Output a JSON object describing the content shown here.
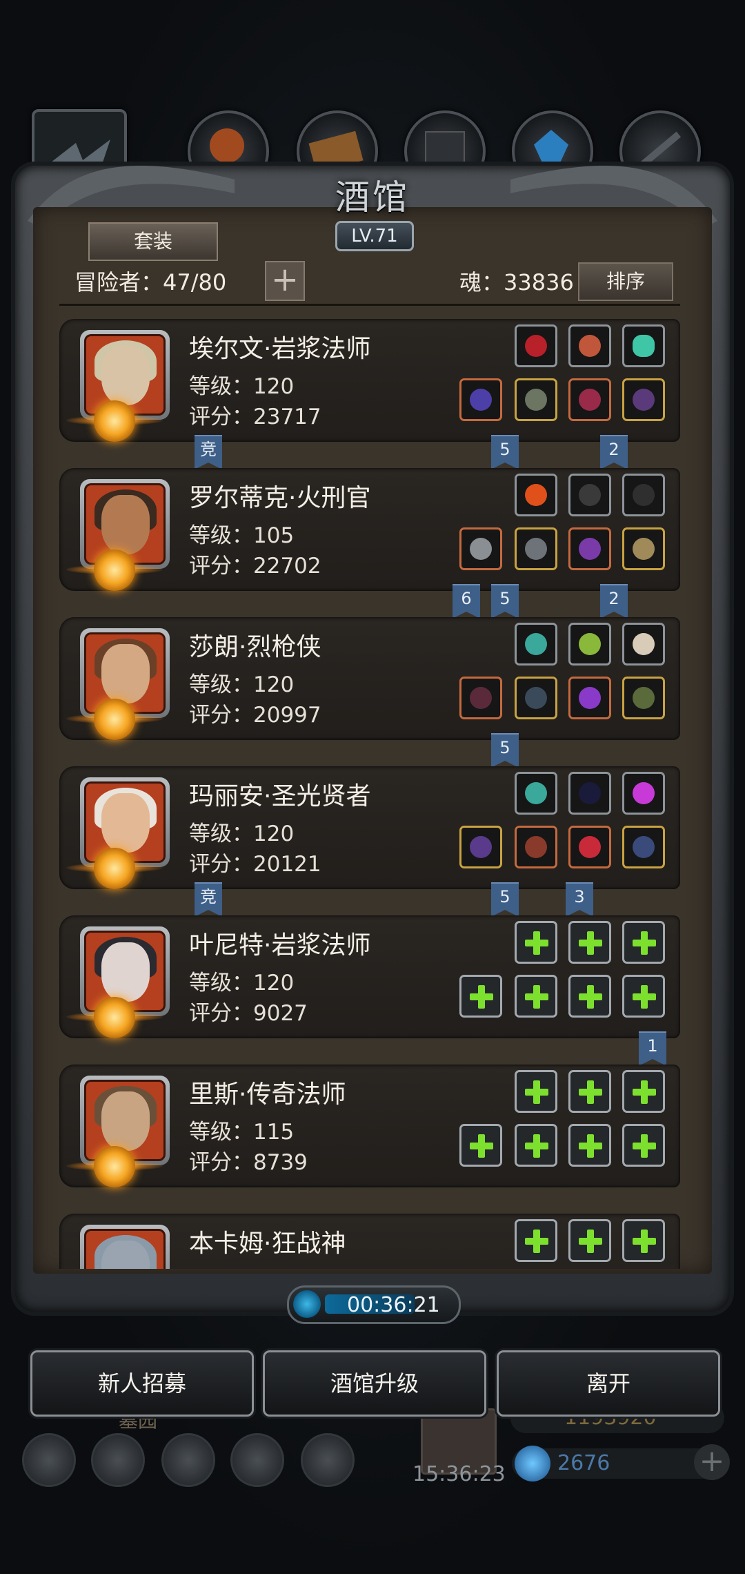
{
  "title": "酒馆",
  "level": "LV.71",
  "set_button": "套装",
  "adventurers": "冒险者：47/80",
  "plus": "+",
  "soul": "魂：33836",
  "sort_button": "排序",
  "heroes": [
    {
      "name": "埃尔文·岩浆法师",
      "level": "等级：120",
      "score": "评分：23717",
      "flags": [
        "竞",
        "5",
        "2"
      ]
    },
    {
      "name": "罗尔蒂克·火刑官",
      "level": "等级：105",
      "score": "评分：22702",
      "flags": [
        "6",
        "5",
        "2"
      ]
    },
    {
      "name": "莎朗·烈枪侠",
      "level": "等级：120",
      "score": "评分：20997",
      "flags": [
        "5"
      ]
    },
    {
      "name": "玛丽安·圣光贤者",
      "level": "等级：120",
      "score": "评分：20121",
      "flags": [
        "竞",
        "5",
        "3"
      ]
    },
    {
      "name": "叶尼特·岩浆法师",
      "level": "等级：120",
      "score": "评分：9027",
      "flags": [
        "1"
      ]
    },
    {
      "name": "里斯·传奇法师",
      "level": "等级：115",
      "score": "评分：8739",
      "flags": []
    },
    {
      "name": "本卡姆·狂战神",
      "level": "",
      "score": "",
      "flags": []
    }
  ],
  "timer": "00:36:21",
  "buttons": {
    "recruit": "新人招募",
    "upgrade": "酒馆升级",
    "leave": "离开"
  },
  "background": {
    "area_label": "墓园",
    "gold": "1193920",
    "time": "15:36:23",
    "gems": "2676"
  }
}
